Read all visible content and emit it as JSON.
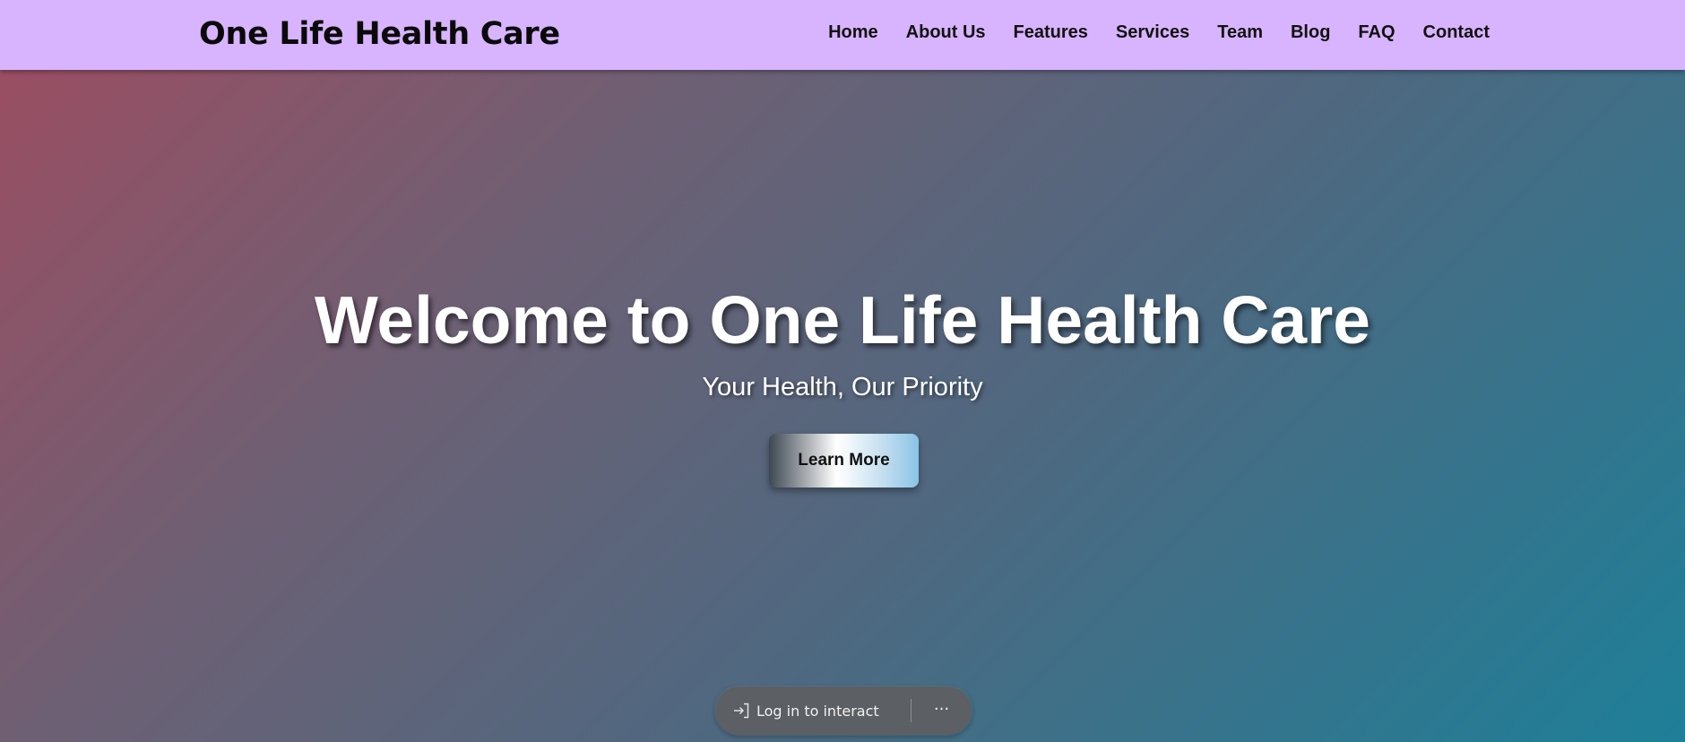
{
  "header": {
    "brand": "One Life Health Care",
    "nav": [
      {
        "label": "Home"
      },
      {
        "label": "About Us"
      },
      {
        "label": "Features"
      },
      {
        "label": "Services"
      },
      {
        "label": "Team"
      },
      {
        "label": "Blog"
      },
      {
        "label": "FAQ"
      },
      {
        "label": "Contact"
      }
    ]
  },
  "hero": {
    "title": "Welcome to One Life Health Care",
    "subtitle": "Your Health, Our Priority",
    "cta_label": "Learn More"
  },
  "overlay": {
    "login_label": "Log in to interact",
    "login_icon": "sign-in-icon",
    "more_icon": "more-horizontal-icon",
    "more_label": "···"
  },
  "colors": {
    "nav_background": "#d8b4fe",
    "hero_gradient_start": "#9a4e62",
    "hero_gradient_end": "#1e7f98"
  }
}
